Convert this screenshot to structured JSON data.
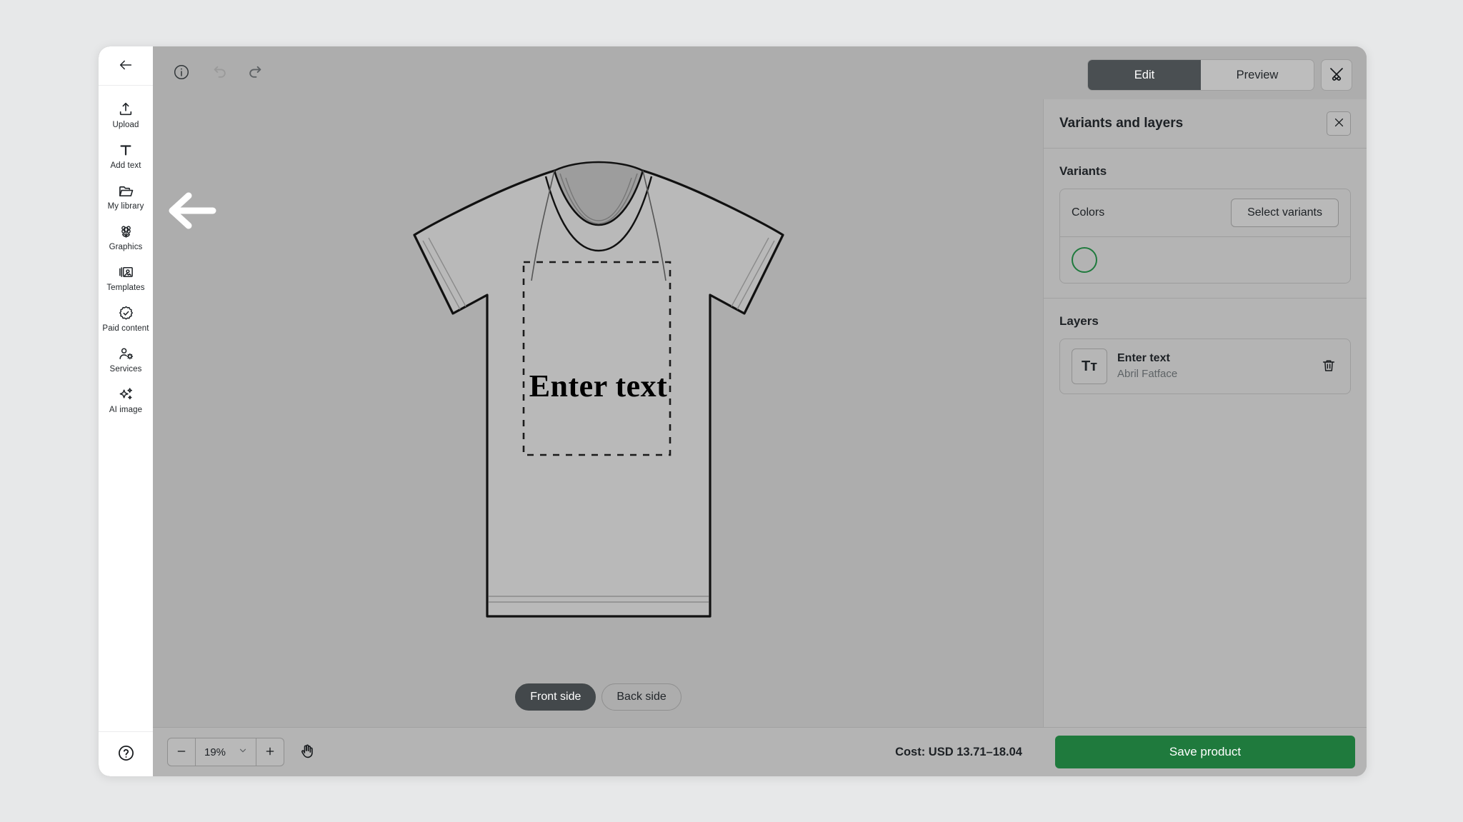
{
  "app": {
    "back_icon": "arrow-left-icon",
    "help_icon": "help-circle-icon"
  },
  "sidebar": {
    "items": [
      {
        "label": "Upload",
        "icon": "upload-icon"
      },
      {
        "label": "Add text",
        "icon": "text-t-icon"
      },
      {
        "label": "My library",
        "icon": "folder-icon"
      },
      {
        "label": "Graphics",
        "icon": "graphics-flower-icon"
      },
      {
        "label": "Templates",
        "icon": "templates-icon"
      },
      {
        "label": "Paid content",
        "icon": "badge-check-icon"
      },
      {
        "label": "Services",
        "icon": "person-gear-icon"
      },
      {
        "label": "AI image",
        "icon": "sparkles-icon"
      }
    ]
  },
  "toolbar": {
    "info_icon": "info-circle-icon",
    "undo_icon": "undo-icon",
    "redo_icon": "redo-icon",
    "edit_label": "Edit",
    "preview_label": "Preview",
    "edit_active": true,
    "tools_icon": "design-tools-icon"
  },
  "canvas": {
    "product": "t-shirt-front",
    "design_text": "Enter text",
    "print_area": "dashed-print-boundary"
  },
  "side_toggle": {
    "front_label": "Front side",
    "back_label": "Back side",
    "active": "Front side"
  },
  "panel": {
    "title": "Variants and layers",
    "close_icon": "close-icon",
    "variants": {
      "heading": "Variants",
      "colors_label": "Colors",
      "select_variants_label": "Select variants",
      "swatches": [
        {
          "name": "grey",
          "color": "#b3b3b3",
          "selected": true,
          "ring_color": "#1f7a3d"
        }
      ]
    },
    "layers": {
      "heading": "Layers",
      "items": [
        {
          "thumb_icon": "text-tt-icon",
          "thumb_glyph": "Tт",
          "name": "Enter text",
          "font": "Abril Fatface",
          "delete_icon": "trash-icon"
        }
      ]
    }
  },
  "bottombar": {
    "zoom_out_icon": "minus-icon",
    "zoom_in_icon": "plus-icon",
    "zoom_value": "19%",
    "zoom_caret_icon": "chevron-down-icon",
    "pan_icon": "hand-pan-icon",
    "cost_text": "Cost: USD 13.71–18.04",
    "save_label": "Save product",
    "save_color": "#1f7a3d"
  },
  "overlay": {
    "arrow_icon": "arrow-left-annotation",
    "arrow_color": "#ffffff"
  }
}
